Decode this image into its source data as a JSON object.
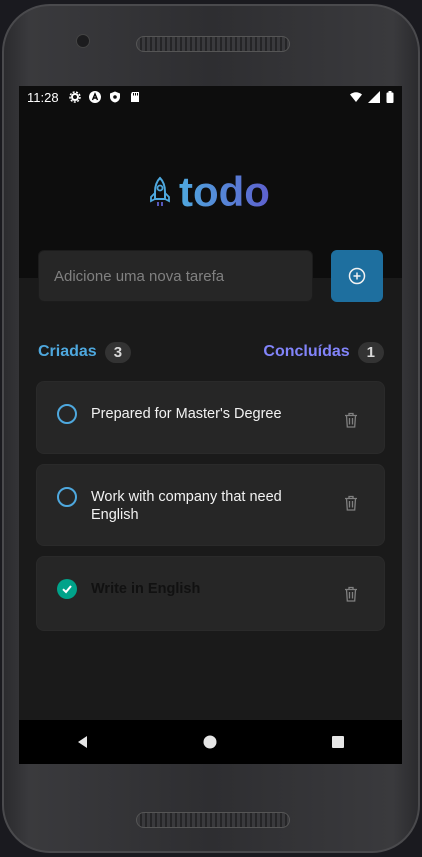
{
  "status_bar": {
    "time": "11:28",
    "left_icons": [
      "gear-icon",
      "a-circle-icon",
      "shield-icon",
      "sd-card-icon"
    ],
    "right_icons": [
      "wifi-icon",
      "signal-icon",
      "battery-icon"
    ]
  },
  "header": {
    "logo_text": "todo",
    "logo_icon": "rocket-icon"
  },
  "new_task": {
    "placeholder": "Adicione uma nova tarefa",
    "value": "",
    "add_icon": "plus-circle-icon"
  },
  "counters": {
    "created_label": "Criadas",
    "created_count": "3",
    "done_label": "Concluídas",
    "done_count": "1"
  },
  "tasks": [
    {
      "text": "Prepared for Master's Degree",
      "done": false
    },
    {
      "text": "Work with company that need English",
      "done": false
    },
    {
      "text": "Write in English",
      "done": true
    }
  ],
  "colors": {
    "accent_blue": "#4ea8de",
    "accent_purple": "#5e60ce",
    "button_blue": "#1e6f9f",
    "done_green": "#00a38a"
  },
  "nav": {
    "icons": [
      "back-icon",
      "home-icon",
      "recents-icon"
    ]
  }
}
